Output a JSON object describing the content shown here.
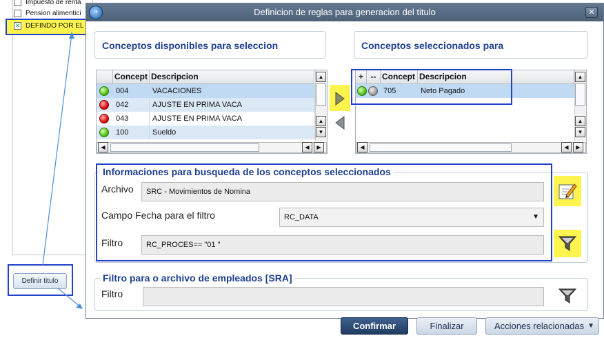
{
  "background_window": {
    "items": [
      {
        "label": "Impuesto de renta",
        "checked": false
      },
      {
        "label": "Pension alimentici",
        "checked": false
      },
      {
        "label": "DEFINDO POR EL",
        "checked": true
      }
    ],
    "define_button": "Definir titulo"
  },
  "dialog": {
    "title": "Definicion de reglas para generacion del titulo",
    "close": "✕",
    "left_panel": {
      "title": "Conceptos disponibles para seleccion",
      "columns": [
        "Concept",
        "Descripcion"
      ],
      "rows": [
        {
          "status": "green",
          "code": "004",
          "desc": "VACACIONES"
        },
        {
          "status": "red",
          "code": "042",
          "desc": "AJUSTE EN PRIMA VACA"
        },
        {
          "status": "red",
          "code": "043",
          "desc": "AJUSTE EN PRIMA VACA"
        },
        {
          "status": "green",
          "code": "100",
          "desc": "Sueldo"
        }
      ]
    },
    "right_panel": {
      "title": "Conceptos seleccionados para",
      "columns": [
        "+",
        "--",
        "Concept",
        "Descripcion"
      ],
      "rows": [
        {
          "status": "green",
          "status2": "gray",
          "code": "705",
          "desc": "Neto Pagado"
        }
      ]
    },
    "search_info": {
      "legend": "Informaciones para busqueda de los conceptos seleccionados",
      "archivo_label": "Archivo",
      "archivo_value": "SRC - Movimientos de Nomina",
      "campo_label": "Campo Fecha para el filtro",
      "campo_value": "RC_DATA",
      "filtro_label": "Filtro",
      "filtro_value": "RC_PROCES== \"01   \""
    },
    "employee_filter": {
      "legend": "Filtro para o archivo de empleados [SRA]",
      "filtro_label": "Filtro",
      "filtro_value": ""
    },
    "buttons": {
      "confirm": "Confirmar",
      "finalize": "Finalizar",
      "actions": "Acciones relacionadas"
    }
  },
  "colors": {
    "titlebar": "#56697f",
    "panel_title": "#1d3f8f",
    "highlight_box": "#2340c8",
    "highlight_fill": "#fdf54d",
    "confirm_bg": "#2b4a74"
  }
}
